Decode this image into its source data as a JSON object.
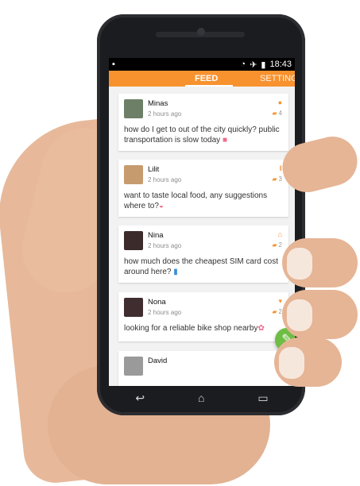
{
  "status_bar": {
    "time": "18:43",
    "icons": [
      "notification-icon",
      "wifi-icon",
      "airplane-icon",
      "battery-icon"
    ]
  },
  "tabs": [
    {
      "label": "FEED",
      "active": true
    },
    {
      "label": "SETTINGS",
      "active": false
    }
  ],
  "posts": [
    {
      "name": "Minas",
      "time": "2 hours ago",
      "category_icon": "globe-icon",
      "comments": "4",
      "message": "how do I get to out of the city quickly? public transportation is slow today"
    },
    {
      "name": "Lilit",
      "time": "2 hours ago",
      "category_icon": "fork-knife-icon",
      "comments": "3",
      "message": "want to taste local food, any suggestions where to?"
    },
    {
      "name": "Nina",
      "time": "2 hours ago",
      "category_icon": "home-icon",
      "comments": "2",
      "message": "how much does the cheapest SIM card cost around here?"
    },
    {
      "name": "Nona",
      "time": "2 hours ago",
      "category_icon": "cart-icon",
      "comments": "2",
      "message": "looking for a reliable bike shop nearby"
    },
    {
      "name": "David",
      "time": "",
      "category_icon": "building-icon",
      "comments": "",
      "message": ""
    }
  ],
  "colors": {
    "accent": "#f7922f",
    "fab": "#6ebd45",
    "background": "#f2f2f2"
  }
}
